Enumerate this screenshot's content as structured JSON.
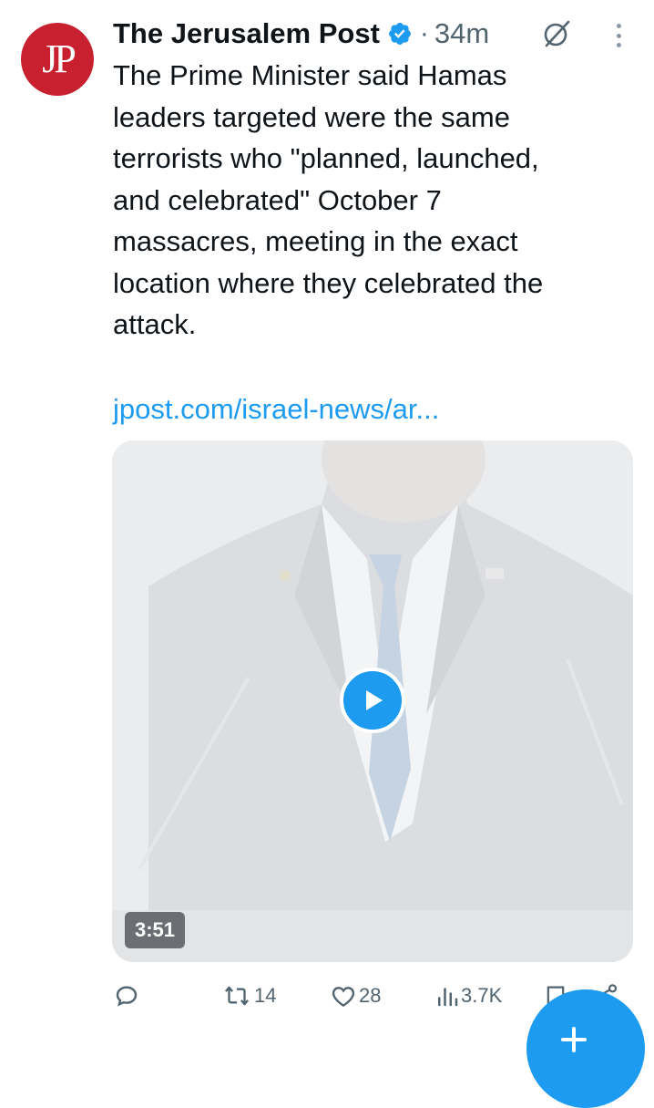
{
  "author": {
    "name": "The Jerusalem Post",
    "avatar_text": "JP",
    "verified": true
  },
  "meta": {
    "separator": "·",
    "time": "34m"
  },
  "tweet": {
    "text": "The Prime Minister said Hamas\nleaders targeted were the same\nterrorists who \"planned, launched,\nand celebrated\" October 7\nmassacres, meeting in the exact\nlocation where they celebrated the\nattack.",
    "link": "jpost.com/israel-news/ar..."
  },
  "media": {
    "duration": "3:51"
  },
  "actions": {
    "replies": "",
    "retweets": "14",
    "likes": "28",
    "views": "3.7K"
  },
  "colors": {
    "accent": "#1d9bf0",
    "brand": "#c8202f",
    "muted": "#536471"
  },
  "icons": [
    "verified-badge-icon",
    "grok-icon",
    "more-options-icon",
    "play-icon",
    "reply-icon",
    "retweet-icon",
    "like-icon",
    "views-icon",
    "bookmark-icon",
    "share-icon",
    "compose-icon"
  ]
}
